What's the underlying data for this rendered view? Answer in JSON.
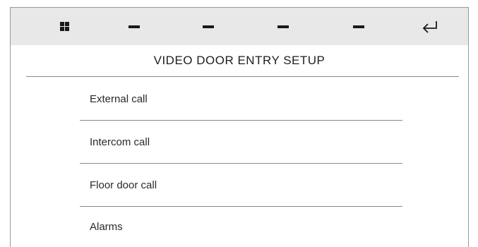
{
  "toolbar": {
    "buttons": [
      {
        "icon": "grid-icon"
      },
      {
        "icon": "dash-icon"
      },
      {
        "icon": "dash-icon"
      },
      {
        "icon": "dash-icon"
      },
      {
        "icon": "dash-icon"
      },
      {
        "icon": "return-arrow-icon"
      }
    ]
  },
  "page": {
    "title": "VIDEO DOOR ENTRY SETUP"
  },
  "menu": {
    "items": [
      {
        "label": "External call"
      },
      {
        "label": "Intercom call"
      },
      {
        "label": "Floor door call"
      },
      {
        "label": "Alarms"
      }
    ]
  },
  "colors": {
    "toolbar_bg": "#e8e8e8",
    "icon": "#1a1a1a",
    "divider": "#8a8a8a"
  }
}
